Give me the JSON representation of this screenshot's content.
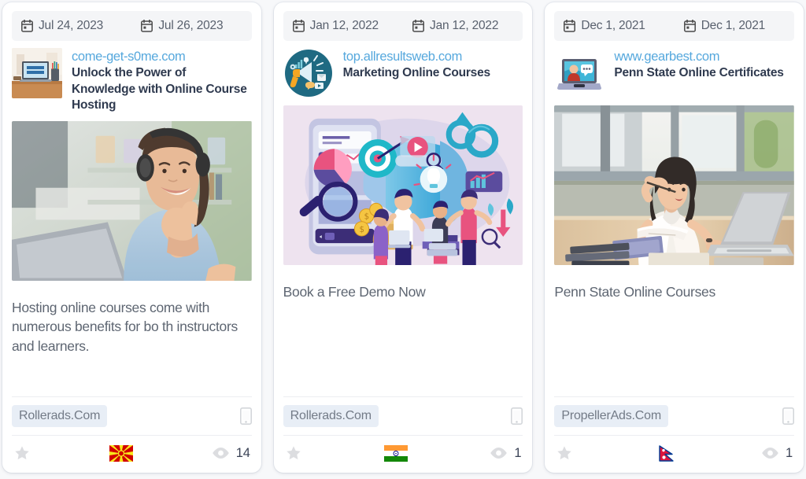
{
  "cards": [
    {
      "date_start": "Jul 24, 2023",
      "date_end": "Jul 26, 2023",
      "domain": "come-get-s0me.com",
      "title": "Unlock the Power of Knowledge with Online Course Hosting",
      "thumb_icon": "online-course-laptop-thumbnail",
      "hero_icon": "woman-headphones-thumbs-up-photo",
      "description": "Hosting online courses come with numerous benefits for bo th instructors and learners.",
      "network": "Rollerads.Com",
      "device_icon": "mobile-icon",
      "star_icon": "star-icon",
      "flag_icon": "flag-north-macedonia",
      "flag_name": "North Macedonia",
      "views_icon": "eye-icon",
      "views": "14"
    },
    {
      "date_start": "Jan 12, 2022",
      "date_end": "Jan 12, 2022",
      "domain": "top.allresultsweb.com",
      "title": "Marketing Online Courses",
      "thumb_icon": "megaphone-marketing-logo",
      "hero_icon": "digital-marketing-illustration",
      "description": "Book a Free Demo Now",
      "network": "Rollerads.Com",
      "device_icon": "mobile-icon",
      "star_icon": "star-icon",
      "flag_icon": "flag-india",
      "flag_name": "India",
      "views_icon": "eye-icon",
      "views": "1"
    },
    {
      "date_start": "Dec 1, 2021",
      "date_end": "Dec 1, 2021",
      "domain": "www.gearbest.com",
      "title": "Penn State Online Certificates",
      "thumb_icon": "laptop-video-call-logo",
      "hero_icon": "woman-working-laptop-desk-photo",
      "description": "Penn State Online Courses",
      "network": "PropellerAds.Com",
      "device_icon": "mobile-icon",
      "star_icon": "star-icon",
      "flag_icon": "flag-nepal",
      "flag_name": "Nepal",
      "views_icon": "eye-icon",
      "views": "1"
    }
  ],
  "colors": {
    "page_bg": "#f7f8fa",
    "card_bg": "#ffffff",
    "date_bar_bg": "#f4f5f7",
    "domain_link": "#56a8dd",
    "title_text": "#2f3a4f",
    "body_text": "#5e6672",
    "pill_bg": "#e8eef6",
    "pill_text": "#737b87",
    "icon_gray": "#d8dade"
  }
}
